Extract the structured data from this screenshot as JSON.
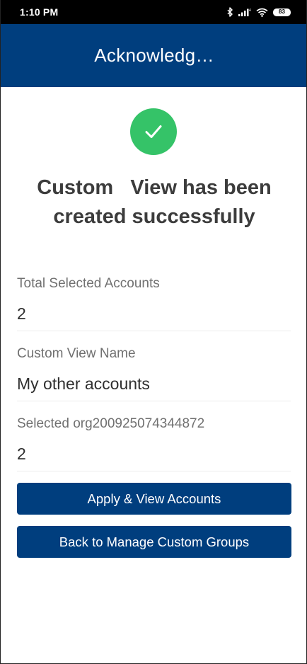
{
  "status_bar": {
    "time": "1:10 PM",
    "battery": "83",
    "icons": [
      "bluetooth-icon",
      "signal-icon",
      "wifi-icon",
      "battery-icon"
    ]
  },
  "app_bar": {
    "title": "Acknowledg…"
  },
  "success": {
    "icon": "checkmark-icon",
    "color": "#35c368",
    "headline_line1": "Custom   View has been",
    "headline_line2": "created successfully"
  },
  "fields": [
    {
      "label": "Total Selected Accounts",
      "value": "2"
    },
    {
      "label": "Custom View Name",
      "value": "My other accounts"
    },
    {
      "label": "Selected org200925074344872",
      "value": "2"
    }
  ],
  "buttons": {
    "apply_label": "Apply & View Accounts",
    "back_label": "Back to Manage Custom Groups"
  },
  "colors": {
    "primary": "#003e7e",
    "success": "#35c368",
    "status_bar": "#000000"
  }
}
